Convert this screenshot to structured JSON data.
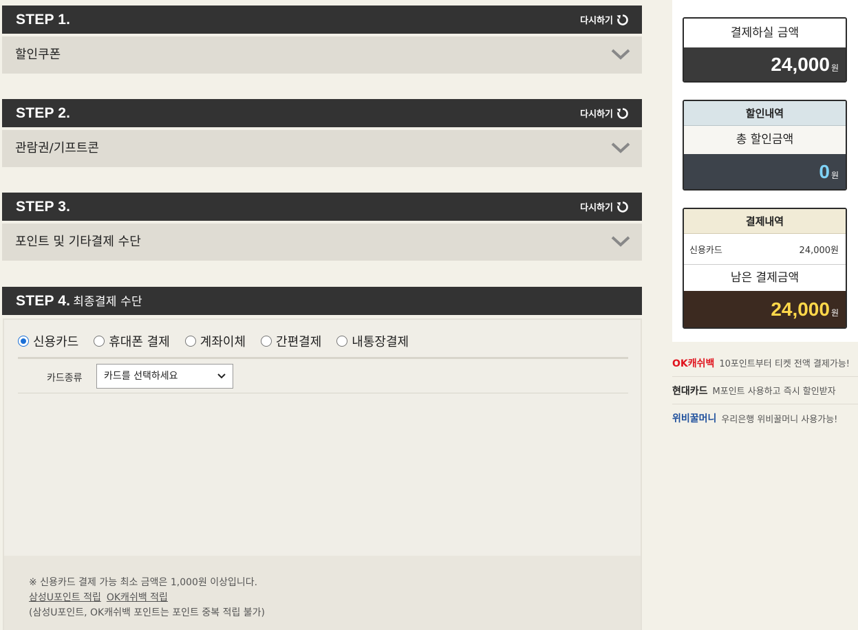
{
  "steps": [
    {
      "title": "STEP 1.",
      "subtitle": "",
      "reset": "다시하기",
      "row": "할인쿠폰"
    },
    {
      "title": "STEP 2.",
      "subtitle": "",
      "reset": "다시하기",
      "row": "관람권/기프트콘"
    },
    {
      "title": "STEP 3.",
      "subtitle": "",
      "reset": "다시하기",
      "row": "포인트 및 기타결제 수단"
    },
    {
      "title": "STEP 4.",
      "subtitle": "최종결제 수단"
    }
  ],
  "payment": {
    "methods": [
      {
        "label": "신용카드",
        "selected": true
      },
      {
        "label": "휴대폰 결제",
        "selected": false
      },
      {
        "label": "계좌이체",
        "selected": false
      },
      {
        "label": "간편결제",
        "selected": false
      },
      {
        "label": "내통장결제",
        "selected": false
      }
    ],
    "card_type_label": "카드종류",
    "card_select_value": "카드를 선택하세요",
    "notice_line1": "※ 신용카드 결제 가능 최소 금액은 1,000원 이상입니다.",
    "link_samsung": "삼성U포인트 적립",
    "link_ok": "OK캐쉬백 적립",
    "notice_line3": "(삼성U포인트, OK캐쉬백 포인트는 포인트 중복 적립 불가)"
  },
  "summary": {
    "pay_title": "결제하실 금액",
    "pay_amount": "24,000",
    "won": "원",
    "discount_header": "할인내역",
    "discount_title": "총 할인금액",
    "discount_amount": "0",
    "payment_header": "결제내역",
    "payment_item_label": "신용카드",
    "payment_item_value": "24,000원",
    "remaining_title": "남은 결제금액",
    "remaining_amount": "24,000"
  },
  "ads": [
    {
      "brand": "OK캐쉬백",
      "brand_color": "#e0141e",
      "text": "10포인트부터 티켓 전액 결제가능!"
    },
    {
      "brand": "현대카드",
      "brand_color": "#222222",
      "text": "M포인트 사용하고 즉시 할인받자"
    },
    {
      "brand": "위비꿀머니",
      "brand_color": "#1e4f9c",
      "text": "우리은행 위비꿀머니 사용가능!"
    }
  ],
  "colors": {
    "step_bar": "#333333",
    "accent_blue": "#7fd3f7",
    "accent_yellow": "#ffd84a"
  }
}
